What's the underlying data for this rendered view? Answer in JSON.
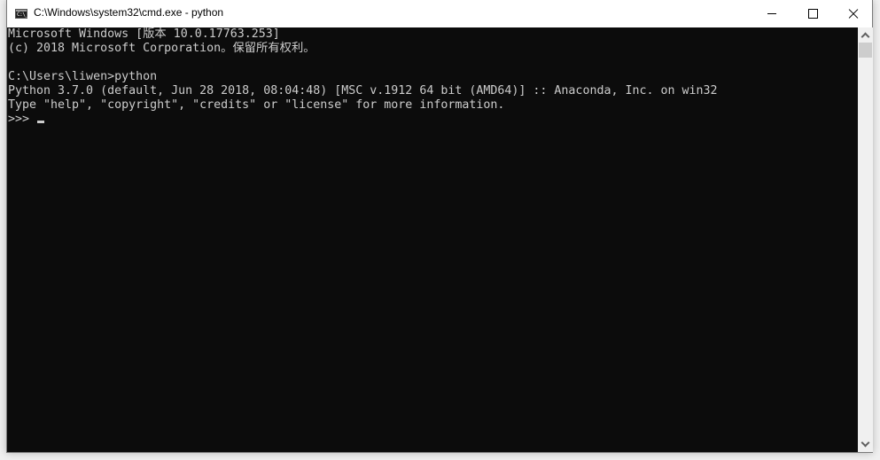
{
  "window": {
    "title": "C:\\Windows\\system32\\cmd.exe - python",
    "app_icon": "cmd-icon",
    "app_icon_text": "C:\\_",
    "controls": {
      "minimize": "minimize-icon",
      "maximize": "maximize-icon",
      "close": "close-icon"
    }
  },
  "console": {
    "lines": [
      "Microsoft Windows [版本 10.0.17763.253]",
      "(c) 2018 Microsoft Corporation。保留所有权利。",
      "",
      "C:\\Users\\liwen>python",
      "Python 3.7.0 (default, Jun 28 2018, 08:04:48) [MSC v.1912 64 bit (AMD64)] :: Anaconda, Inc. on win32",
      "Type \"help\", \"copyright\", \"credits\" or \"license\" for more information."
    ],
    "prompt": ">>> ",
    "colors": {
      "background": "#0c0c0c",
      "foreground": "#cccccc"
    }
  },
  "scrollbar": {
    "up_icon": "chevron-up-icon",
    "down_icon": "chevron-down-icon",
    "position": 0
  }
}
